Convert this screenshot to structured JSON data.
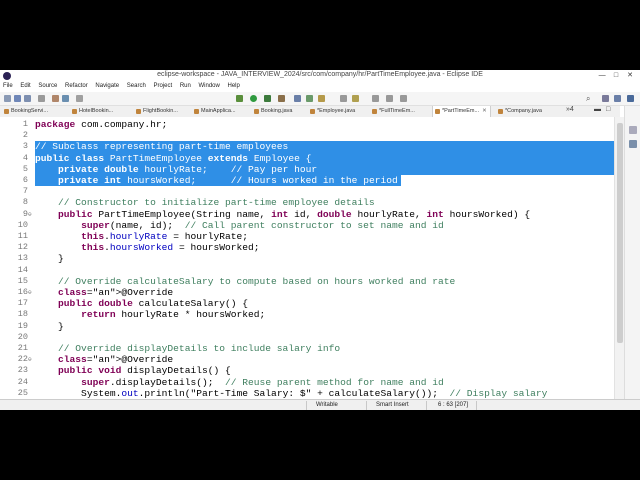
{
  "window": {
    "title": "eclipse-workspace - JAVA_INTERVIEW_2024/src/com/company/hr/PartTimeEmployee.java - Eclipse IDE",
    "controls": [
      "—",
      "□",
      "✕"
    ]
  },
  "menu": [
    "File",
    "Edit",
    "Source",
    "Refactor",
    "Navigate",
    "Search",
    "Project",
    "Run",
    "Window",
    "Help"
  ],
  "tabs": [
    {
      "label": "BookingServi...",
      "active": false
    },
    {
      "label": "HotelBookin...",
      "active": false
    },
    {
      "label": "FlightBookin...",
      "active": false
    },
    {
      "label": "MainApplica...",
      "active": false
    },
    {
      "label": "Booking.java",
      "active": false
    },
    {
      "label": "*Employee.java",
      "active": false
    },
    {
      "label": "*FullTimeEm...",
      "active": false
    },
    {
      "label": "*PartTimeEm...",
      "active": true
    },
    {
      "label": "*Company.java",
      "active": false
    }
  ],
  "tab_overflow": "»4",
  "editor": {
    "lines": [
      {
        "n": "1",
        "fold": "",
        "text": "package com.company.hr;",
        "sel": ""
      },
      {
        "n": "2",
        "fold": "",
        "text": "",
        "sel": ""
      },
      {
        "n": "3",
        "fold": "",
        "text": "// Subclass representing part-time employees",
        "sel": "full"
      },
      {
        "n": "4",
        "fold": "",
        "text": "public class PartTimeEmployee extends Employee {",
        "sel": "full"
      },
      {
        "n": "5",
        "fold": "",
        "text": "    private double hourlyRate;    // Pay per hour",
        "sel": "full"
      },
      {
        "n": "6",
        "fold": "",
        "text": "    private int hoursWorked;      // Hours worked in the period",
        "sel": "partial"
      },
      {
        "n": "7",
        "fold": "",
        "text": "",
        "sel": ""
      },
      {
        "n": "8",
        "fold": "",
        "text": "    // Constructor to initialize part-time employee details",
        "sel": ""
      },
      {
        "n": "9",
        "fold": "⊖",
        "text": "    public PartTimeEmployee(String name, int id, double hourlyRate, int hoursWorked) {",
        "sel": ""
      },
      {
        "n": "10",
        "fold": "",
        "text": "        super(name, id);  // Call parent constructor to set name and id",
        "sel": ""
      },
      {
        "n": "11",
        "fold": "",
        "text": "        this.hourlyRate = hourlyRate;",
        "sel": ""
      },
      {
        "n": "12",
        "fold": "",
        "text": "        this.hoursWorked = hoursWorked;",
        "sel": ""
      },
      {
        "n": "13",
        "fold": "",
        "text": "    }",
        "sel": ""
      },
      {
        "n": "14",
        "fold": "",
        "text": "",
        "sel": ""
      },
      {
        "n": "15",
        "fold": "",
        "text": "    // Override calculateSalary to compute based on hours worked and rate",
        "sel": ""
      },
      {
        "n": "16",
        "fold": "⊖",
        "text": "    @Override",
        "sel": ""
      },
      {
        "n": "17",
        "fold": "",
        "text": "    public double calculateSalary() {",
        "sel": ""
      },
      {
        "n": "18",
        "fold": "",
        "text": "        return hourlyRate * hoursWorked;",
        "sel": ""
      },
      {
        "n": "19",
        "fold": "",
        "text": "    }",
        "sel": ""
      },
      {
        "n": "20",
        "fold": "",
        "text": "",
        "sel": ""
      },
      {
        "n": "21",
        "fold": "",
        "text": "    // Override displayDetails to include salary info",
        "sel": ""
      },
      {
        "n": "22",
        "fold": "⊖",
        "text": "    @Override",
        "sel": ""
      },
      {
        "n": "23",
        "fold": "",
        "text": "    public void displayDetails() {",
        "sel": ""
      },
      {
        "n": "24",
        "fold": "",
        "text": "        super.displayDetails();  // Reuse parent method for name and id",
        "sel": ""
      },
      {
        "n": "25",
        "fold": "",
        "text": "        System.out.println(\"Part-Time Salary: $\" + calculateSalary());  // Display salary",
        "sel": ""
      }
    ]
  },
  "status": {
    "mode": "Writable",
    "insert": "Smart Insert",
    "position": "6 : 63 [207]"
  }
}
